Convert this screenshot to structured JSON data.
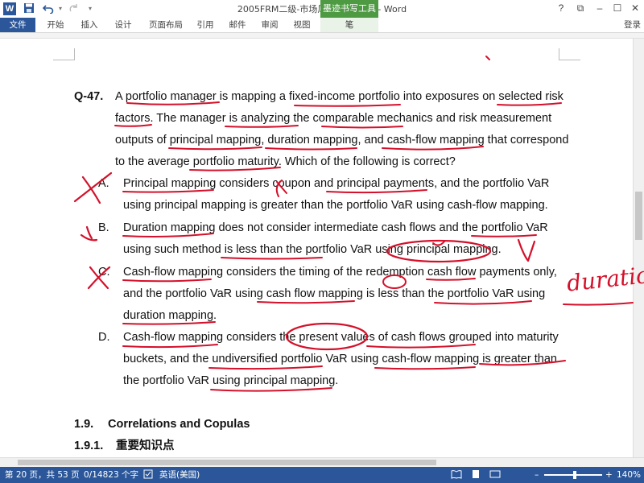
{
  "window": {
    "title": "2005FRM二级-市场风险百题_高云 - Word",
    "context_tool_label": "墨迹书写工具",
    "icons": [
      "word-icon",
      "save-icon",
      "undo-icon",
      "redo-icon",
      "customize-icon"
    ],
    "controls": {
      "help": "?",
      "restore": "⧉",
      "minimize": "–",
      "maximize": "☐",
      "close": "✕"
    }
  },
  "ribbon": {
    "tabs": [
      "文件",
      "开始",
      "插入",
      "设计",
      "页面布局",
      "引用",
      "邮件",
      "审阅",
      "视图",
      "笔"
    ],
    "login": "登录",
    "accent_color": "#2b579a",
    "ink_context_color": "#4e9a43"
  },
  "question": {
    "label": "Q-47.",
    "stem_lines": [
      "A portfolio manager is mapping a fixed-income portfolio into exposures on selected risk",
      "factors. The manager is analyzing the comparable mechanics and risk measurement",
      "outputs of principal mapping, duration mapping, and cash-flow mapping that correspond",
      "to the average portfolio maturity. Which of the following is correct?"
    ],
    "options": [
      {
        "label": "A.",
        "lines": [
          "Principal mapping considers coupon and principal payments, and the portfolio VaR",
          "using principal mapping is greater than the portfolio VaR using cash-flow mapping."
        ]
      },
      {
        "label": "B.",
        "lines": [
          "Duration mapping does not consider intermediate cash flows and the portfolio VaR",
          "using such method is less than the portfolio VaR using principal mapping."
        ]
      },
      {
        "label": "C.",
        "lines": [
          "Cash-flow mapping considers the timing of the redemption cash flow payments only,",
          "and the portfolio VaR using cash flow mapping is less than the portfolio VaR using",
          "duration mapping."
        ]
      },
      {
        "label": "D.",
        "lines": [
          "Cash-flow mapping considers the present values of cash flows grouped into maturity",
          "buckets, and the undiversified portfolio VaR using cash-flow mapping is greater than",
          "the portfolio VaR using principal mapping."
        ]
      }
    ]
  },
  "section": {
    "number": "1.9.",
    "title": "Correlations and Copulas"
  },
  "subsection": {
    "number": "1.9.1.",
    "title": "重要知识点"
  },
  "annotations": {
    "ink_color": "#d4102a",
    "handwritten_word": "duration"
  },
  "status": {
    "page": "第 20 页，共 53 页",
    "words": "0/14823 个字",
    "language": "英语(美国)",
    "zoom": "140%",
    "zoom_minus": "–",
    "zoom_plus": "+"
  }
}
